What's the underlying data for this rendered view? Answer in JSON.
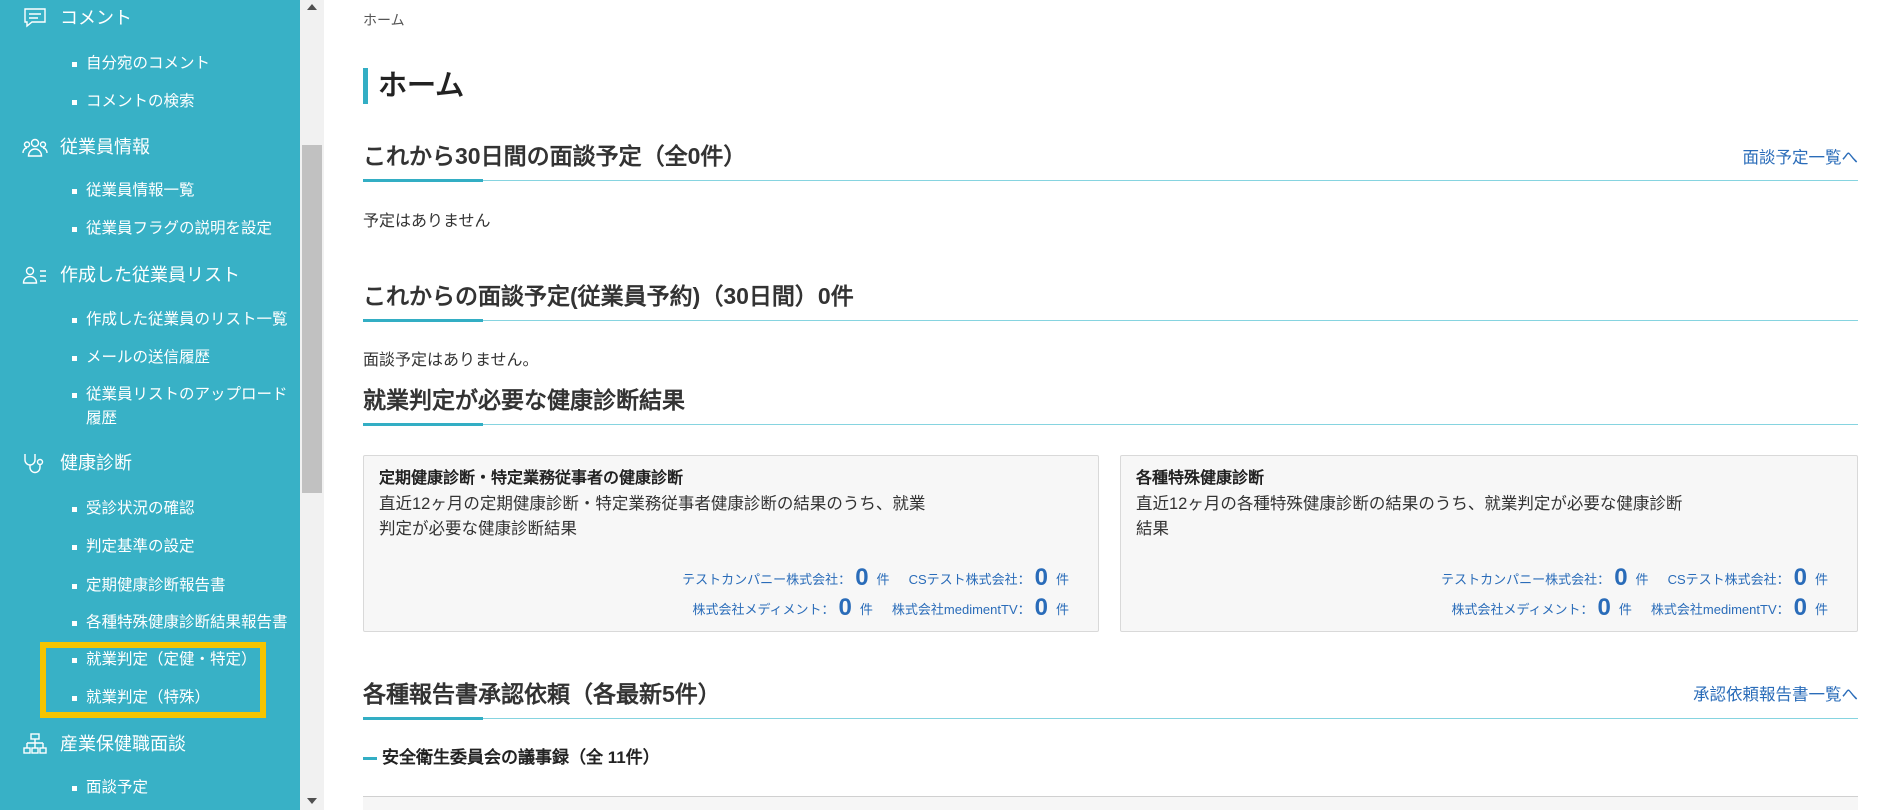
{
  "colors": {
    "sidebar_bg": "#38b1c6",
    "accent": "#33aec4",
    "accent_light": "#86d4e0",
    "link": "#2a6cb9",
    "highlight": "#f5c400"
  },
  "sidebar": {
    "sections": [
      {
        "icon": "comment-icon",
        "title": "コメント",
        "items": [
          "自分宛のコメント",
          "コメントの検索"
        ]
      },
      {
        "icon": "people-icon",
        "title": "従業員情報",
        "items": [
          "従業員情報一覧",
          "従業員フラグの説明を設定"
        ]
      },
      {
        "icon": "person-list-icon",
        "title": "作成した従業員リスト",
        "items": [
          "作成した従業員のリスト一覧",
          "メールの送信履歴",
          "従業員リストのアップロード履歴"
        ]
      },
      {
        "icon": "stethoscope-icon",
        "title": "健康診断",
        "items": [
          "受診状況の確認",
          "判定基準の設定",
          "定期健康診断報告書",
          "各種特殊健康診断結果報告書",
          "就業判定（定健・特定）",
          "就業判定（特殊）"
        ]
      },
      {
        "icon": "org-chart-icon",
        "title": "産業保健職面談",
        "items": [
          "面談予定"
        ]
      }
    ]
  },
  "breadcrumb": "ホーム",
  "page_title": "ホーム",
  "sections": {
    "upcoming": {
      "heading": "これから30日間の面談予定（全0件）",
      "link": "面談予定一覧へ",
      "empty": "予定はありません"
    },
    "employee_booking": {
      "heading": "これからの面談予定(従業員予約)（30日間）0件",
      "empty": "面談予定はありません。"
    },
    "judgement": {
      "heading": "就業判定が必要な健康診断結果",
      "cards": [
        {
          "title": "定期健康診断・特定業務従事者の健康診断",
          "desc": "直近12ヶ月の定期健康診断・特定業務従事者健康診断の結果のうち、就業判定が必要な健康診断結果",
          "stats": [
            {
              "company": "テストカンパニー株式会社：",
              "count": 0,
              "unit": "件"
            },
            {
              "company": "CSテスト株式会社：",
              "count": 0,
              "unit": "件"
            },
            {
              "company": "株式会社メディメント：",
              "count": 0,
              "unit": "件"
            },
            {
              "company": "株式会社medimentTV：",
              "count": 0,
              "unit": "件"
            }
          ]
        },
        {
          "title": "各種特殊健康診断",
          "desc": "直近12ヶ月の各種特殊健康診断の結果のうち、就業判定が必要な健康診断結果",
          "stats": [
            {
              "company": "テストカンパニー株式会社：",
              "count": 0,
              "unit": "件"
            },
            {
              "company": "CSテスト株式会社：",
              "count": 0,
              "unit": "件"
            },
            {
              "company": "株式会社メディメント：",
              "count": 0,
              "unit": "件"
            },
            {
              "company": "株式会社medimentTV：",
              "count": 0,
              "unit": "件"
            }
          ]
        }
      ]
    },
    "reports": {
      "heading": "各種報告書承認依頼（各最新5件）",
      "link": "承認依頼報告書一覧へ",
      "sub_heading": "安全衛生委員会の議事録（全 11件）"
    }
  }
}
